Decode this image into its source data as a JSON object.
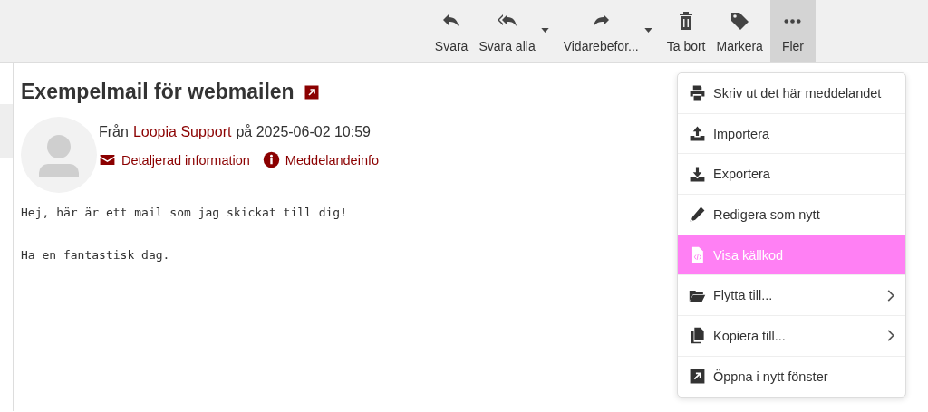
{
  "toolbar": [
    {
      "kind": "reply",
      "label": "Svara",
      "dropdown": false,
      "selected": false
    },
    {
      "kind": "reply-all",
      "label": "Svara alla",
      "dropdown": true,
      "selected": false
    },
    {
      "kind": "forward",
      "label": "Vidarebefor...",
      "dropdown": true,
      "selected": false
    },
    {
      "kind": "trash",
      "label": "Ta bort",
      "dropdown": false,
      "selected": false
    },
    {
      "kind": "tag",
      "label": "Markera",
      "dropdown": false,
      "selected": false
    },
    {
      "kind": "dots",
      "label": "Fler",
      "dropdown": false,
      "selected": true
    }
  ],
  "message": {
    "subject": "Exempelmail för webmailen",
    "from_prefix": "Från",
    "sender": "Loopia Support",
    "date_text": "på 2025-06-02 10:59",
    "links": [
      {
        "kind": "envelope",
        "label": "Detaljerad information"
      },
      {
        "kind": "info",
        "label": "Meddelandeinfo"
      }
    ],
    "body": [
      "Hej, här är ett mail som jag skickat till dig!",
      "Ha en fantastisk dag."
    ]
  },
  "menu": [
    {
      "kind": "print",
      "label": "Skriv ut det här meddelandet",
      "submenu": false,
      "selected": false
    },
    {
      "kind": "upload",
      "label": "Importera",
      "submenu": false,
      "selected": false
    },
    {
      "kind": "download",
      "label": "Exportera",
      "submenu": false,
      "selected": false
    },
    {
      "kind": "pencil",
      "label": "Redigera som nytt",
      "submenu": false,
      "selected": false
    },
    {
      "kind": "code-file",
      "label": "Visa källkod",
      "submenu": false,
      "selected": true
    },
    {
      "kind": "folder",
      "label": "Flytta till...",
      "submenu": true,
      "selected": false
    },
    {
      "kind": "copy",
      "label": "Kopiera till...",
      "submenu": true,
      "selected": false
    },
    {
      "kind": "external",
      "label": "Öppna i nytt fönster",
      "submenu": false,
      "selected": false
    }
  ]
}
